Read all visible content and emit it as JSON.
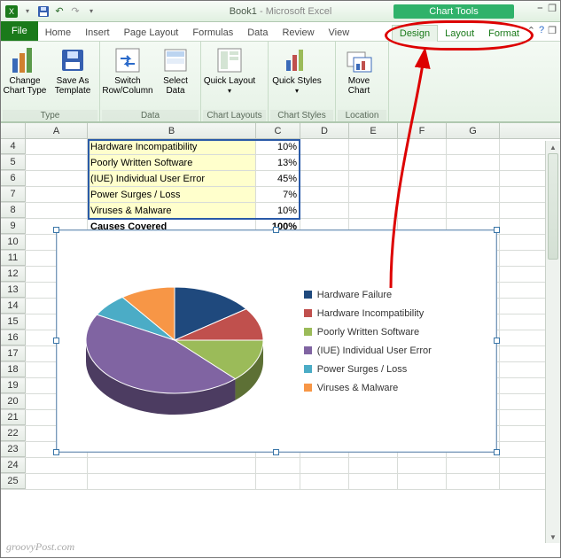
{
  "title": {
    "doc": "Book1",
    "app": "Microsoft Excel",
    "sep": " - "
  },
  "chart_tools_label": "Chart Tools",
  "win": {
    "min": "⎯",
    "restore": "❐"
  },
  "tabs": {
    "file": "File",
    "main": [
      "Home",
      "Insert",
      "Page Layout",
      "Formulas",
      "Data",
      "Review",
      "View"
    ],
    "context": [
      "Design",
      "Layout",
      "Format"
    ]
  },
  "ribbon": {
    "type": {
      "label": "Type",
      "change": "Change Chart Type",
      "saveas": "Save As Template"
    },
    "data": {
      "label": "Data",
      "switch": "Switch Row/Column",
      "select": "Select Data"
    },
    "layouts": {
      "label": "Chart Layouts",
      "quick": "Quick Layout"
    },
    "styles": {
      "label": "Chart Styles",
      "quick": "Quick Styles"
    },
    "location": {
      "label": "Location",
      "move": "Move Chart"
    }
  },
  "columns": [
    "A",
    "B",
    "C",
    "D",
    "E",
    "F",
    "G"
  ],
  "row_start": 4,
  "row_count": 22,
  "table_rows": [
    {
      "b": "Hardware Incompatibility",
      "c": "10%"
    },
    {
      "b": "Poorly Written Software",
      "c": "13%"
    },
    {
      "b": "(IUE) Individual User Error",
      "c": "45%"
    },
    {
      "b": "Power Surges / Loss",
      "c": "7%"
    },
    {
      "b": "Viruses & Malware",
      "c": "10%"
    },
    {
      "b": "Causes Covered",
      "c": "100%",
      "bold": true,
      "plain": true
    }
  ],
  "chart_data": {
    "type": "pie",
    "title": "",
    "series": [
      {
        "name": "Hardware Failure",
        "value": 15,
        "color": "#1f497d"
      },
      {
        "name": "Hardware Incompatibility",
        "value": 10,
        "color": "#c0504d"
      },
      {
        "name": "Poorly Written Software",
        "value": 13,
        "color": "#9bbb59"
      },
      {
        "name": "(IUE) Individual User Error",
        "value": 45,
        "color": "#8064a2"
      },
      {
        "name": "Power Surges / Loss",
        "value": 7,
        "color": "#4bacc6"
      },
      {
        "name": "Viruses & Malware",
        "value": 10,
        "color": "#f79646"
      }
    ]
  },
  "watermark": "groovyPost.com"
}
